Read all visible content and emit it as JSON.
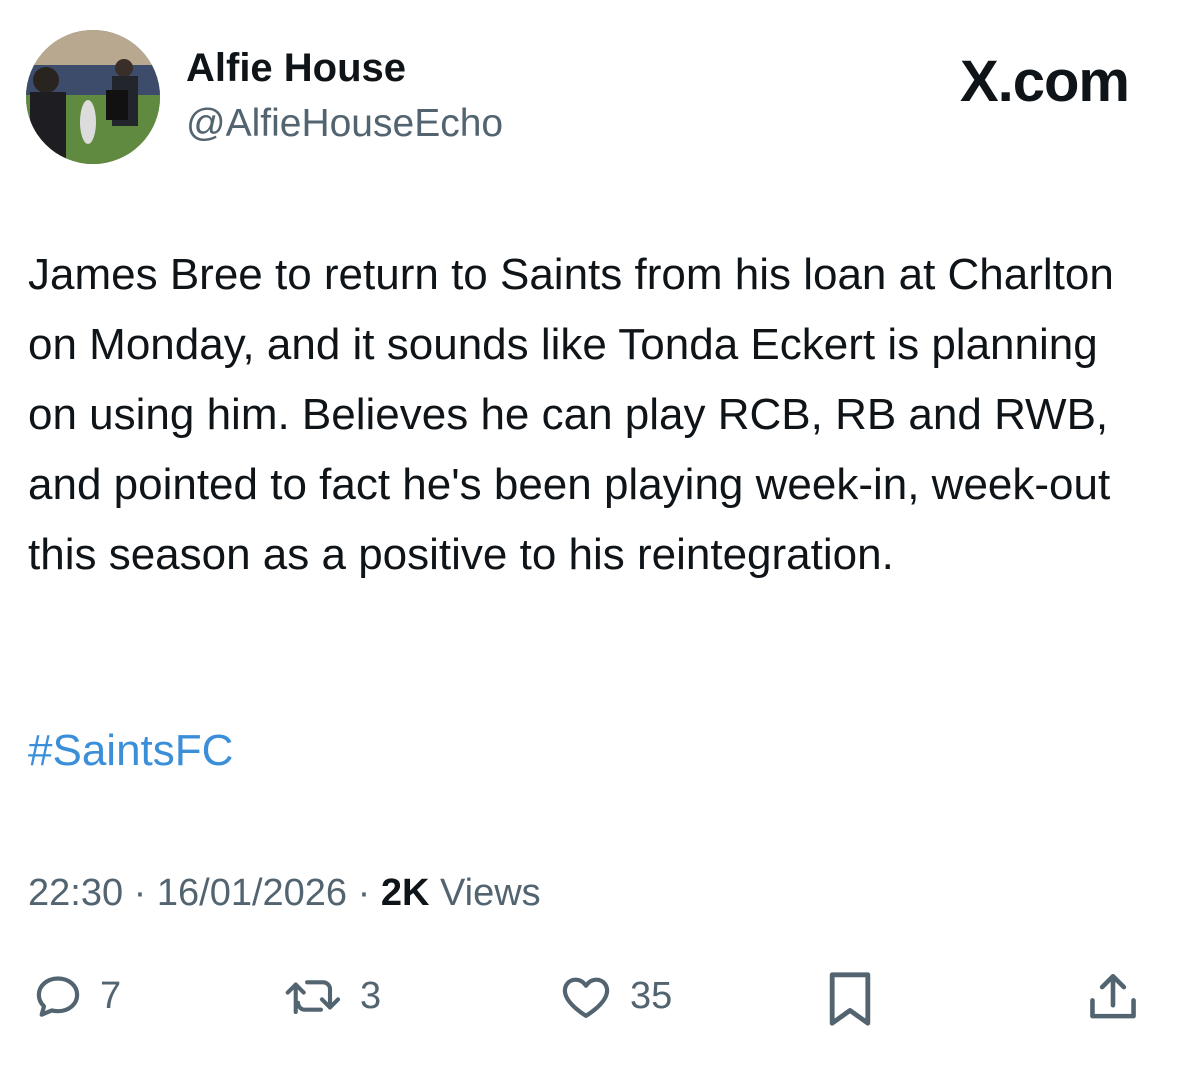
{
  "author": {
    "display_name": "Alfie House",
    "handle": "@AlfieHouseEcho"
  },
  "brand": "X.com",
  "tweet": {
    "text": "James Bree to return to Saints from his loan at Charlton on Monday, and it sounds like Tonda Eckert is planning on using him. Believes he can play RCB, RB and RWB, and pointed to fact he's been playing week-in, week-out this season as a positive to his reintegration.",
    "hashtag": "#SaintsFC"
  },
  "meta": {
    "time": "22:30",
    "separator": "·",
    "date": "16/01/2026",
    "views_count": "2K",
    "views_label": "Views"
  },
  "actions": {
    "reply": {
      "icon": "reply-icon",
      "count": "7"
    },
    "repost": {
      "icon": "repost-icon",
      "count": "3"
    },
    "like": {
      "icon": "heart-icon",
      "count": "35"
    },
    "bookmark": {
      "icon": "bookmark-icon"
    },
    "share": {
      "icon": "share-icon"
    }
  },
  "colors": {
    "text": "#0f1419",
    "secondary": "#536471",
    "hashtag": "#3b8fd9"
  }
}
